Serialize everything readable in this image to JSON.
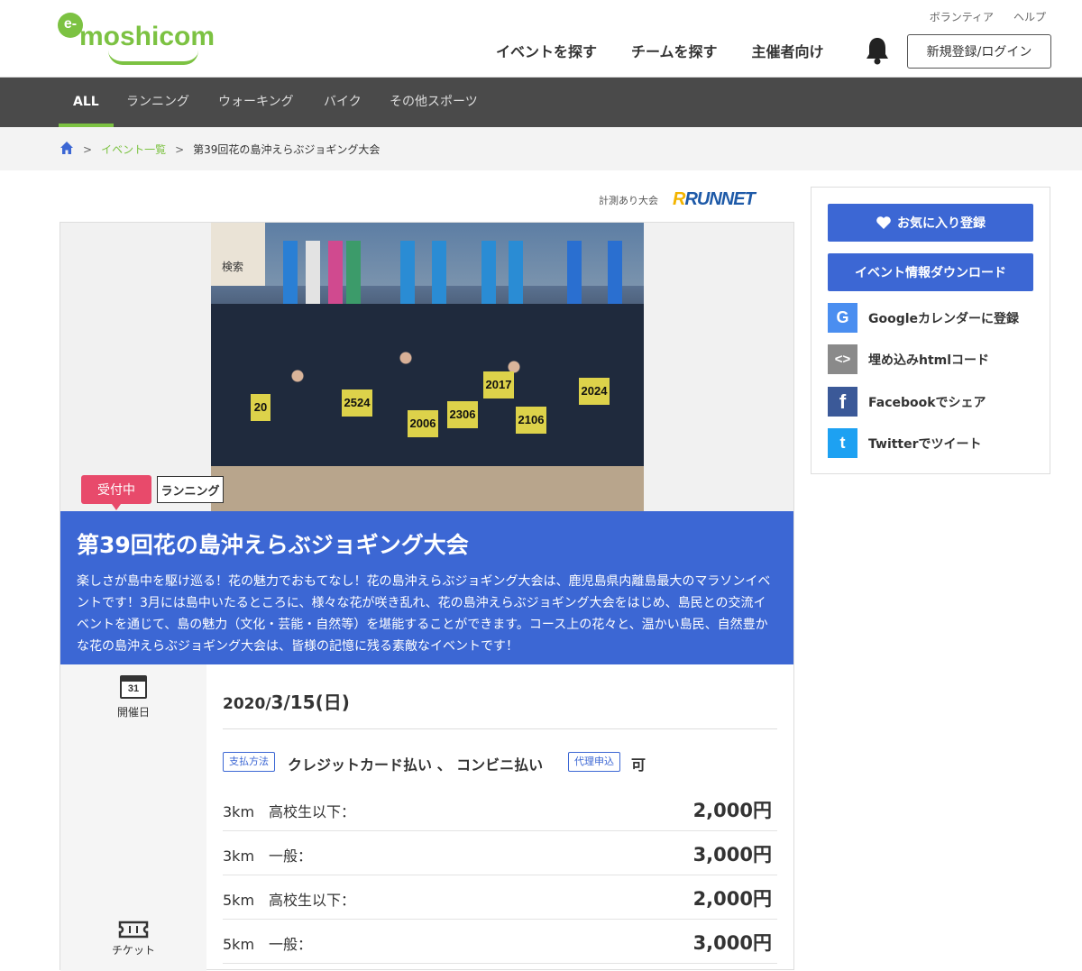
{
  "header": {
    "logo_text": "moshicom",
    "logo_badge": "e-",
    "toplinks": [
      "ボランティア",
      "ヘルプ"
    ],
    "nav": [
      "イベントを探す",
      "チームを探す",
      "主催者向け"
    ],
    "login_label": "新規登録/ログイン"
  },
  "categories": [
    "ALL",
    "ランニング",
    "ウォーキング",
    "バイク",
    "その他スポーツ"
  ],
  "breadcrumb": {
    "sep": ">",
    "link": "イベント一覧",
    "current": "第39回花の島沖えらぶジョギング大会"
  },
  "runnet": {
    "label": "計測あり大会",
    "logo_r": "R",
    "logo_text": "RUNNET"
  },
  "photo": {
    "sign_text": "検索",
    "bibs": [
      "2524",
      "2006",
      "2306",
      "2106",
      "2017",
      "2024",
      "20"
    ]
  },
  "event": {
    "status": "受付中",
    "category": "ランニング",
    "title": "第39回花の島沖えらぶジョギング大会",
    "description": "楽しさが島中を駆け巡る！花の魅力でおもてなし！花の島沖えらぶジョギング大会は、鹿児島県内離島最大のマラソンイベントです！3月には島中いたるところに、様々な花が咲き乱れ、花の島沖えらぶジョギング大会をはじめ、島民との交流イベントを通じて、島の魅力（文化・芸能・自然等）を堪能することができます。コース上の花々と、温かい島民、自然豊かな花の島沖えらぶジョギング大会は、皆様の記憶に残る素敵なイベントです！",
    "date_icon_num": "31",
    "date_label": "開催日",
    "date_year": "2020/",
    "date_day": "3/15(日)",
    "ticket_label": "チケット",
    "pay_tag": "支払方法",
    "pay_methods": "クレジットカード払い 、 コンビニ払い",
    "proxy_tag": "代理申込",
    "proxy_value": "可",
    "fees": [
      {
        "label": "3km　高校生以下：",
        "price": "2,000円"
      },
      {
        "label": "3km　一般：",
        "price": "3,000円"
      },
      {
        "label": "5km　高校生以下：",
        "price": "2,000円"
      },
      {
        "label": "5km　一般：",
        "price": "3,000円"
      }
    ]
  },
  "side": {
    "favorite": "お気に入り登録",
    "download": "イベント情報ダウンロード",
    "links": [
      {
        "icon": "G",
        "label": "Googleカレンダーに登録",
        "color": "#4a8ef0"
      },
      {
        "icon": "<>",
        "label": "埋め込みhtmlコード",
        "color": "#8a8a8a"
      },
      {
        "icon": "f",
        "label": "Facebookでシェア",
        "color": "#3b5998"
      },
      {
        "icon": "t",
        "label": "Twitterでツイート",
        "color": "#1da1f2"
      }
    ]
  },
  "colors": {
    "brand_green": "#7cc242",
    "accent_blue": "#3c67d4",
    "status_pink": "#e84a6b",
    "catbar": "#4a4a4a"
  }
}
